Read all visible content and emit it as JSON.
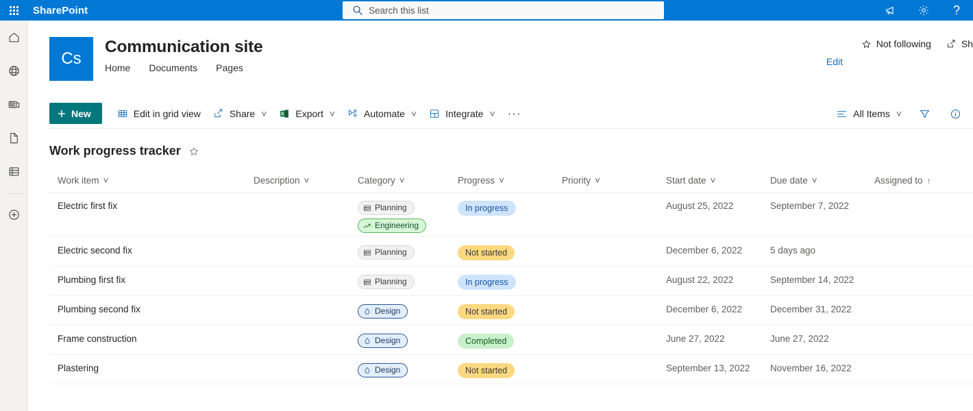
{
  "suite": {
    "brand": "SharePoint",
    "waffle_icon": "app-launcher-icon",
    "search": {
      "placeholder": "Search this list",
      "value": "",
      "icon": "search-icon"
    },
    "actions": [
      {
        "name": "announcements-button",
        "icon": "megaphone-icon",
        "label": ""
      },
      {
        "name": "settings-button",
        "icon": "gear-icon",
        "label": ""
      },
      {
        "name": "help-button",
        "icon": "question-mark-icon",
        "label": "?"
      }
    ],
    "brand_color": "#0078d4"
  },
  "rail": {
    "items": [
      {
        "name": "rail-home",
        "icon": "home-icon"
      },
      {
        "name": "rail-global",
        "icon": "globe-icon"
      },
      {
        "name": "rail-news",
        "icon": "news-icon"
      },
      {
        "name": "rail-page",
        "icon": "file-page-icon"
      },
      {
        "name": "rail-lists",
        "icon": "list-stack-icon"
      },
      {
        "name": "rail-create",
        "icon": "plus-circle-icon"
      }
    ]
  },
  "site": {
    "logo_initials": "Cs",
    "logo_color": "#0078d4",
    "title": "Communication site",
    "nav": [
      {
        "label": "Home"
      },
      {
        "label": "Documents"
      },
      {
        "label": "Pages"
      }
    ],
    "edit_label": "Edit",
    "follow": {
      "label": "Not following",
      "icon": "star-outline-icon"
    },
    "share": {
      "label": "Sh",
      "icon": "share-icon"
    }
  },
  "commandbar": {
    "new_label": "New",
    "new_icon": "plus-icon",
    "new_color": "#03787c",
    "items": [
      {
        "label": "Edit in grid view",
        "icon": "grid-icon",
        "chevron": false
      },
      {
        "label": "Share",
        "icon": "share-icon",
        "chevron": true
      },
      {
        "label": "Export",
        "icon": "excel-icon",
        "chevron": true
      },
      {
        "label": "Automate",
        "icon": "automate-icon",
        "chevron": true
      },
      {
        "label": "Integrate",
        "icon": "integrate-icon",
        "chevron": true
      }
    ],
    "overflow_label": "···",
    "view_label": "All Items",
    "view_icon": "view-list-icon",
    "filter_icon": "filter-icon",
    "info_icon": "info-icon"
  },
  "list": {
    "title": "Work progress tracker",
    "favorite_icon": "star-outline-icon",
    "columns": [
      {
        "label": "Work item",
        "sorted": false
      },
      {
        "label": "Description",
        "sorted": false
      },
      {
        "label": "Category",
        "sorted": false
      },
      {
        "label": "Progress",
        "sorted": false
      },
      {
        "label": "Priority",
        "sorted": false
      },
      {
        "label": "Start date",
        "sorted": false
      },
      {
        "label": "Due date",
        "sorted": false
      },
      {
        "label": "Assigned to",
        "sorted": true,
        "sort_indicator": "↑"
      }
    ],
    "rows": [
      {
        "work_item": "Electric first fix",
        "description": "",
        "categories": [
          {
            "label": "Planning",
            "style": "tag-planning",
            "icon": "planning-icon"
          },
          {
            "label": "Engineering",
            "style": "tag-engineering",
            "icon": "trending-up-icon"
          }
        ],
        "progress": {
          "label": "In progress",
          "style": "st-inprogress"
        },
        "priority": "",
        "start_date": "August 25, 2022",
        "due_date": "September 7, 2022",
        "assigned_to": ""
      },
      {
        "work_item": "Electric second fix",
        "description": "",
        "categories": [
          {
            "label": "Planning",
            "style": "tag-planning",
            "icon": "planning-icon"
          }
        ],
        "progress": {
          "label": "Not started",
          "style": "st-notstarted"
        },
        "priority": "",
        "start_date": "December 6, 2022",
        "due_date": "5 days ago",
        "assigned_to": ""
      },
      {
        "work_item": "Plumbing first fix",
        "description": "",
        "categories": [
          {
            "label": "Planning",
            "style": "tag-planning",
            "icon": "planning-icon"
          }
        ],
        "progress": {
          "label": "In progress",
          "style": "st-inprogress"
        },
        "priority": "",
        "start_date": "August 22, 2022",
        "due_date": "September 14, 2022",
        "assigned_to": ""
      },
      {
        "work_item": "Plumbing second fix",
        "description": "",
        "categories": [
          {
            "label": "Design",
            "style": "tag-design",
            "icon": "design-icon"
          }
        ],
        "progress": {
          "label": "Not started",
          "style": "st-notstarted"
        },
        "priority": "",
        "start_date": "December 6, 2022",
        "due_date": "December 31, 2022",
        "assigned_to": ""
      },
      {
        "work_item": "Frame construction",
        "description": "",
        "categories": [
          {
            "label": "Design",
            "style": "tag-design",
            "icon": "design-icon"
          }
        ],
        "progress": {
          "label": "Completed",
          "style": "st-completed"
        },
        "priority": "",
        "start_date": "June 27, 2022",
        "due_date": "June 27, 2022",
        "assigned_to": ""
      },
      {
        "work_item": "Plastering",
        "description": "",
        "categories": [
          {
            "label": "Design",
            "style": "tag-design",
            "icon": "design-icon"
          }
        ],
        "progress": {
          "label": "Not started",
          "style": "st-notstarted"
        },
        "priority": "",
        "start_date": "September 13, 2022",
        "due_date": "November 16, 2022",
        "assigned_to": ""
      }
    ]
  }
}
